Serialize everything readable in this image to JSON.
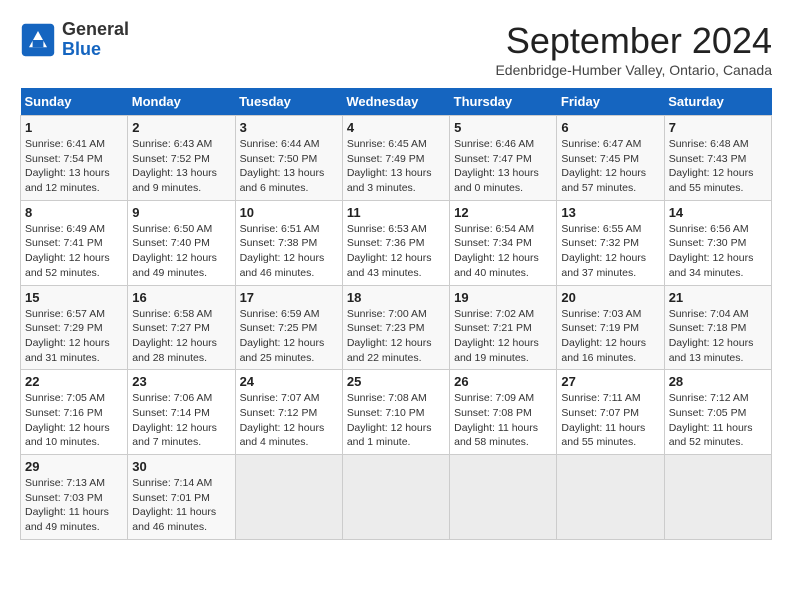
{
  "header": {
    "logo_line1": "General",
    "logo_line2": "Blue",
    "month_title": "September 2024",
    "location": "Edenbridge-Humber Valley, Ontario, Canada"
  },
  "weekdays": [
    "Sunday",
    "Monday",
    "Tuesday",
    "Wednesday",
    "Thursday",
    "Friday",
    "Saturday"
  ],
  "weeks": [
    [
      {
        "day": "1",
        "info": "Sunrise: 6:41 AM\nSunset: 7:54 PM\nDaylight: 13 hours and 12 minutes."
      },
      {
        "day": "2",
        "info": "Sunrise: 6:43 AM\nSunset: 7:52 PM\nDaylight: 13 hours and 9 minutes."
      },
      {
        "day": "3",
        "info": "Sunrise: 6:44 AM\nSunset: 7:50 PM\nDaylight: 13 hours and 6 minutes."
      },
      {
        "day": "4",
        "info": "Sunrise: 6:45 AM\nSunset: 7:49 PM\nDaylight: 13 hours and 3 minutes."
      },
      {
        "day": "5",
        "info": "Sunrise: 6:46 AM\nSunset: 7:47 PM\nDaylight: 13 hours and 0 minutes."
      },
      {
        "day": "6",
        "info": "Sunrise: 6:47 AM\nSunset: 7:45 PM\nDaylight: 12 hours and 57 minutes."
      },
      {
        "day": "7",
        "info": "Sunrise: 6:48 AM\nSunset: 7:43 PM\nDaylight: 12 hours and 55 minutes."
      }
    ],
    [
      {
        "day": "8",
        "info": "Sunrise: 6:49 AM\nSunset: 7:41 PM\nDaylight: 12 hours and 52 minutes."
      },
      {
        "day": "9",
        "info": "Sunrise: 6:50 AM\nSunset: 7:40 PM\nDaylight: 12 hours and 49 minutes."
      },
      {
        "day": "10",
        "info": "Sunrise: 6:51 AM\nSunset: 7:38 PM\nDaylight: 12 hours and 46 minutes."
      },
      {
        "day": "11",
        "info": "Sunrise: 6:53 AM\nSunset: 7:36 PM\nDaylight: 12 hours and 43 minutes."
      },
      {
        "day": "12",
        "info": "Sunrise: 6:54 AM\nSunset: 7:34 PM\nDaylight: 12 hours and 40 minutes."
      },
      {
        "day": "13",
        "info": "Sunrise: 6:55 AM\nSunset: 7:32 PM\nDaylight: 12 hours and 37 minutes."
      },
      {
        "day": "14",
        "info": "Sunrise: 6:56 AM\nSunset: 7:30 PM\nDaylight: 12 hours and 34 minutes."
      }
    ],
    [
      {
        "day": "15",
        "info": "Sunrise: 6:57 AM\nSunset: 7:29 PM\nDaylight: 12 hours and 31 minutes."
      },
      {
        "day": "16",
        "info": "Sunrise: 6:58 AM\nSunset: 7:27 PM\nDaylight: 12 hours and 28 minutes."
      },
      {
        "day": "17",
        "info": "Sunrise: 6:59 AM\nSunset: 7:25 PM\nDaylight: 12 hours and 25 minutes."
      },
      {
        "day": "18",
        "info": "Sunrise: 7:00 AM\nSunset: 7:23 PM\nDaylight: 12 hours and 22 minutes."
      },
      {
        "day": "19",
        "info": "Sunrise: 7:02 AM\nSunset: 7:21 PM\nDaylight: 12 hours and 19 minutes."
      },
      {
        "day": "20",
        "info": "Sunrise: 7:03 AM\nSunset: 7:19 PM\nDaylight: 12 hours and 16 minutes."
      },
      {
        "day": "21",
        "info": "Sunrise: 7:04 AM\nSunset: 7:18 PM\nDaylight: 12 hours and 13 minutes."
      }
    ],
    [
      {
        "day": "22",
        "info": "Sunrise: 7:05 AM\nSunset: 7:16 PM\nDaylight: 12 hours and 10 minutes."
      },
      {
        "day": "23",
        "info": "Sunrise: 7:06 AM\nSunset: 7:14 PM\nDaylight: 12 hours and 7 minutes."
      },
      {
        "day": "24",
        "info": "Sunrise: 7:07 AM\nSunset: 7:12 PM\nDaylight: 12 hours and 4 minutes."
      },
      {
        "day": "25",
        "info": "Sunrise: 7:08 AM\nSunset: 7:10 PM\nDaylight: 12 hours and 1 minute."
      },
      {
        "day": "26",
        "info": "Sunrise: 7:09 AM\nSunset: 7:08 PM\nDaylight: 11 hours and 58 minutes."
      },
      {
        "day": "27",
        "info": "Sunrise: 7:11 AM\nSunset: 7:07 PM\nDaylight: 11 hours and 55 minutes."
      },
      {
        "day": "28",
        "info": "Sunrise: 7:12 AM\nSunset: 7:05 PM\nDaylight: 11 hours and 52 minutes."
      }
    ],
    [
      {
        "day": "29",
        "info": "Sunrise: 7:13 AM\nSunset: 7:03 PM\nDaylight: 11 hours and 49 minutes."
      },
      {
        "day": "30",
        "info": "Sunrise: 7:14 AM\nSunset: 7:01 PM\nDaylight: 11 hours and 46 minutes."
      },
      {
        "day": "",
        "info": ""
      },
      {
        "day": "",
        "info": ""
      },
      {
        "day": "",
        "info": ""
      },
      {
        "day": "",
        "info": ""
      },
      {
        "day": "",
        "info": ""
      }
    ]
  ]
}
